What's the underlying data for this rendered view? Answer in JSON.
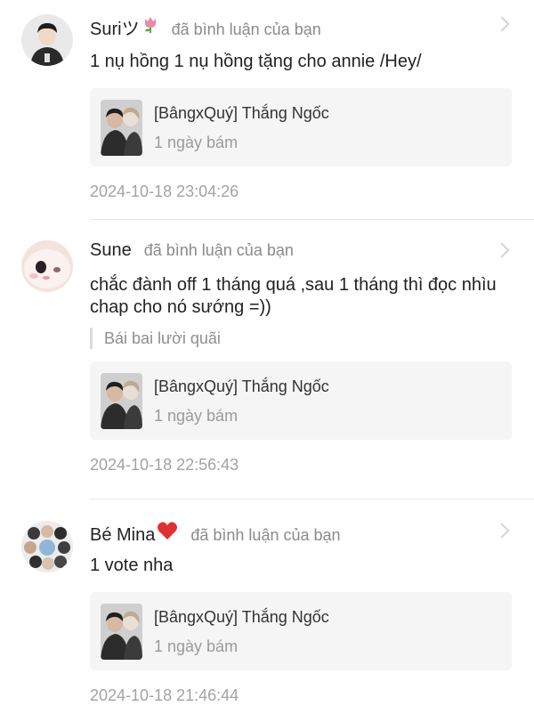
{
  "comments": [
    {
      "username": "Suriツ",
      "emoji": "tulip-emoji",
      "action": "đã bình luận của bạn",
      "text": "1 nụ hồng 1 nụ hồng tặng cho annie /Hey/",
      "quote": "",
      "card": {
        "title": "[BângxQuý] Thắng Ngốc",
        "subtitle": "1 ngày bám"
      },
      "time": "2024-10-18 23:04:26"
    },
    {
      "username": "Sune",
      "emoji": "",
      "action": "đã bình luận của bạn",
      "text": "chắc đành off 1 tháng quá ,sau 1 tháng thì đọc nhìu chap cho nó sướng =))",
      "quote": "Bái bai lười quãi",
      "card": {
        "title": "[BângxQuý] Thắng Ngốc",
        "subtitle": "1 ngày bám"
      },
      "time": "2024-10-18 22:56:43"
    },
    {
      "username": "Bé Mina",
      "emoji": "red-heart-emoji",
      "action": "đã bình luận của bạn",
      "text": "1 vote nha",
      "quote": "",
      "card": {
        "title": "[BângxQuý] Thắng Ngốc",
        "subtitle": "1 ngày bám"
      },
      "time": "2024-10-18 21:46:44"
    }
  ],
  "colors": {
    "username": "#222222",
    "action": "#8a8a8a",
    "card_bg": "#f5f5f5",
    "timestamp": "#a3a3a3",
    "divider": "#e8e8e8"
  }
}
